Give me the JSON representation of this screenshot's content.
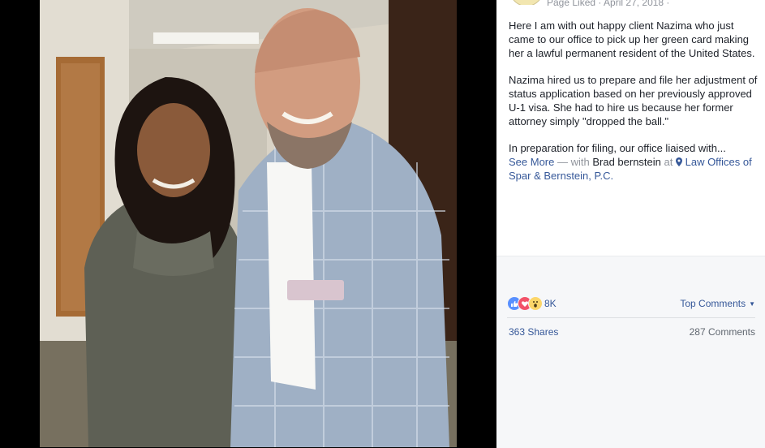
{
  "header": {
    "meta": "Page Liked · April 27, 2018 · "
  },
  "post": {
    "paragraph1": "Here I am with out happy client Nazima who just came to our office to pick up her green card making her a lawful permanent resident of the United States.",
    "paragraph2": "Nazima hired us to prepare and file her adjustment of status application based on her previously approved U-1 visa. She had to hire us because her former attorney simply \"dropped the ball.\"",
    "paragraph3_prefix": "In preparation for filing, our office liaised with...",
    "see_more": "See More",
    "with_text": " — with ",
    "tagged_person": "Brad bernstein",
    "at_text": " at ",
    "location": "Law Offices of Spar & Bernstein, P.C."
  },
  "reactions": {
    "count": "8K",
    "top_comments": "Top Comments",
    "shares": "363 Shares",
    "comments": "287 Comments"
  },
  "icons": {
    "reactions": [
      "like-icon",
      "love-icon",
      "wow-icon"
    ],
    "location": "map-pin-icon",
    "dropdown": "caret-down-icon"
  },
  "colors": {
    "link": "#365899",
    "like": "#5890ff",
    "love": "#f25268",
    "wow": "#fcd669"
  }
}
